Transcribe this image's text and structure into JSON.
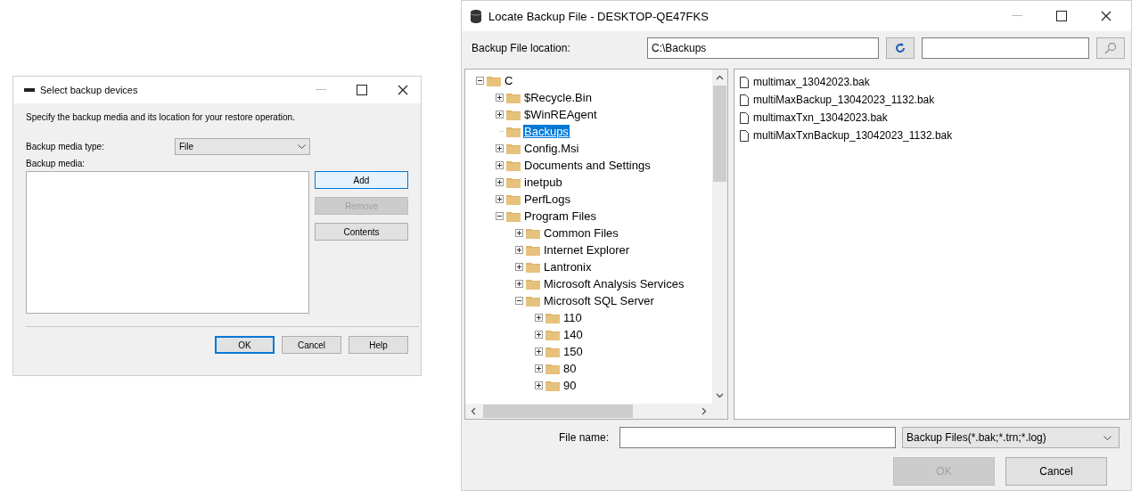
{
  "select_dialog": {
    "title": "Select backup devices",
    "description": "Specify the backup media and its location for your restore operation.",
    "media_type_label": "Backup media type:",
    "media_type": "File",
    "media_label": "Backup media:",
    "side_buttons": [
      {
        "label": "Add",
        "focused": true,
        "disabled": false
      },
      {
        "label": "Remove",
        "focused": false,
        "disabled": true
      },
      {
        "label": "Contents",
        "focused": false,
        "disabled": false
      }
    ],
    "buttons": [
      {
        "label": "OK",
        "focused": true,
        "disabled": false
      },
      {
        "label": "Cancel",
        "focused": false,
        "disabled": false
      },
      {
        "label": "Help",
        "focused": false,
        "disabled": false
      }
    ]
  },
  "locate_dialog": {
    "title": "Locate Backup File - DESKTOP-QE47FKS",
    "location_label": "Backup File location:",
    "location": "C:\\Backups",
    "tree": [
      {
        "label": "C",
        "expandable": true,
        "expanded": true,
        "selected": false,
        "children": [
          {
            "label": "$Recycle.Bin",
            "expandable": true,
            "expanded": false,
            "selected": false
          },
          {
            "label": "$WinREAgent",
            "expandable": true,
            "expanded": false,
            "selected": false
          },
          {
            "label": "Backups",
            "expandable": false,
            "selected": true
          },
          {
            "label": "Config.Msi",
            "expandable": true,
            "expanded": false,
            "selected": false
          },
          {
            "label": "Documents and Settings",
            "expandable": true,
            "expanded": false,
            "selected": false
          },
          {
            "label": "inetpub",
            "expandable": true,
            "expanded": false,
            "selected": false
          },
          {
            "label": "PerfLogs",
            "expandable": true,
            "expanded": false,
            "selected": false
          },
          {
            "label": "Program Files",
            "expandable": true,
            "expanded": true,
            "selected": false,
            "children": [
              {
                "label": "Common Files",
                "expandable": true,
                "expanded": false,
                "selected": false
              },
              {
                "label": "Internet Explorer",
                "expandable": true,
                "expanded": false,
                "selected": false
              },
              {
                "label": "Lantronix",
                "expandable": true,
                "expanded": false,
                "selected": false
              },
              {
                "label": "Microsoft Analysis Services",
                "expandable": true,
                "expanded": false,
                "selected": false
              },
              {
                "label": "Microsoft SQL Server",
                "expandable": true,
                "expanded": true,
                "selected": false,
                "children": [
                  {
                    "label": "110",
                    "expandable": true,
                    "expanded": false,
                    "selected": false
                  },
                  {
                    "label": "140",
                    "expandable": true,
                    "expanded": false,
                    "selected": false
                  },
                  {
                    "label": "150",
                    "expandable": true,
                    "expanded": false,
                    "selected": false
                  },
                  {
                    "label": "80",
                    "expandable": true,
                    "expanded": false,
                    "selected": false
                  },
                  {
                    "label": "90",
                    "expandable": true,
                    "expanded": false,
                    "selected": false
                  }
                ]
              }
            ]
          }
        ]
      }
    ],
    "files": [
      "multimax_13042023.bak",
      "multiMaxBackup_13042023_1132.bak",
      "multimaxTxn_13042023.bak",
      "multiMaxTxnBackup_13042023_1132.bak"
    ],
    "file_name_label": "File name:",
    "file_type": "Backup Files(*.bak;*.trn;*.log)",
    "buttons": [
      {
        "label": "OK",
        "focused": false,
        "disabled": true
      },
      {
        "label": "Cancel",
        "focused": false,
        "disabled": false
      }
    ]
  }
}
